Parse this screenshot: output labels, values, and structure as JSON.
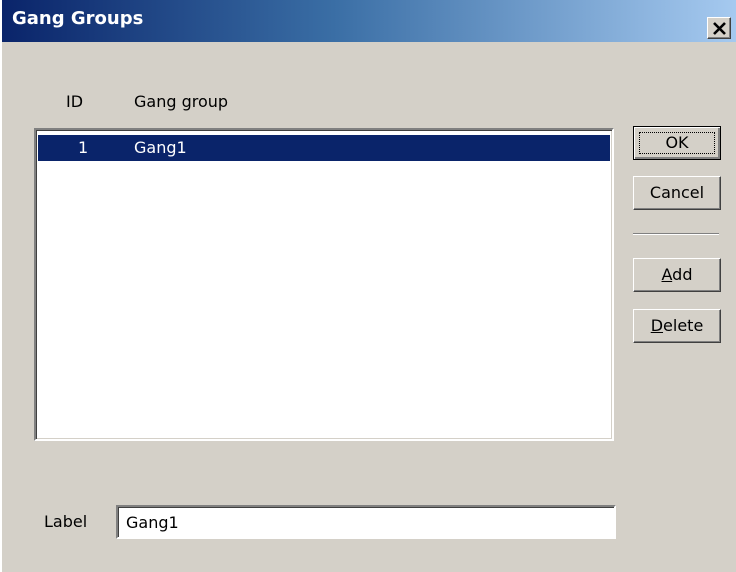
{
  "window": {
    "title": "Gang Groups",
    "close_icon": "close-icon"
  },
  "list": {
    "columns": [
      "ID",
      "Gang group"
    ],
    "rows": [
      {
        "id": "1",
        "name": "Gang1",
        "selected": true
      }
    ]
  },
  "buttons": {
    "ok": "OK",
    "cancel": "Cancel",
    "add": "Add",
    "delete": "Delete"
  },
  "label_field": {
    "label": "Label",
    "value": "Gang1"
  },
  "colors": {
    "dialog_bg": "#d4d0c8",
    "title_gradient_start": "#0a246a",
    "title_gradient_end": "#a6caf0",
    "selection_bg": "#0a246a",
    "selection_fg": "#ffffff"
  }
}
